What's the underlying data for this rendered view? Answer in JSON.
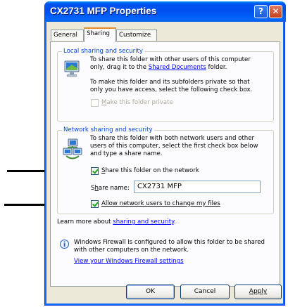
{
  "window": {
    "title": "CX2731 MFP Properties",
    "help_glyph": "?",
    "close_glyph": "✕"
  },
  "tabs": [
    {
      "label": "General"
    },
    {
      "label": "Sharing"
    },
    {
      "label": "Customize"
    }
  ],
  "local": {
    "heading": "Local sharing and security",
    "line1": "To share this folder with other users of this computer",
    "line2_prefix": "only, drag it to the ",
    "line2_link": "Shared Documents",
    "line2_suffix": " folder.",
    "line3": "To make this folder and its subfolders private so that",
    "line4": "only you have access, select the following check box.",
    "private_m": "M",
    "private_rest": "ake this folder private",
    "private_checked": false
  },
  "network": {
    "heading": "Network sharing and security",
    "line1": "To share this folder with both network users and other",
    "line2": "users of this computer, select the first check box below",
    "line3": "and type a share name.",
    "share_s": "S",
    "share_rest": "hare this folder on the network",
    "share_checked": true,
    "sharename_label_1": "S",
    "sharename_label_h": "h",
    "sharename_label_2": "are name:",
    "sharename_value": "CX2731 MFP",
    "allow_w": "Allow network users to change my files",
    "allow_checked": true
  },
  "learn": {
    "prefix": "Learn more about ",
    "link": "sharing and security",
    "suffix": "."
  },
  "firewall": {
    "line1": "Windows Firewall is configured to allow this folder to be shared",
    "line2": "with other computers on the network.",
    "link": "View your Windows Firewall settings"
  },
  "buttons": {
    "ok": "OK",
    "cancel": "Cancel",
    "apply": "Apply"
  },
  "colors": {
    "title_blue": "#0053ee",
    "group_label": "#0046d5",
    "link": "#0000ff"
  }
}
